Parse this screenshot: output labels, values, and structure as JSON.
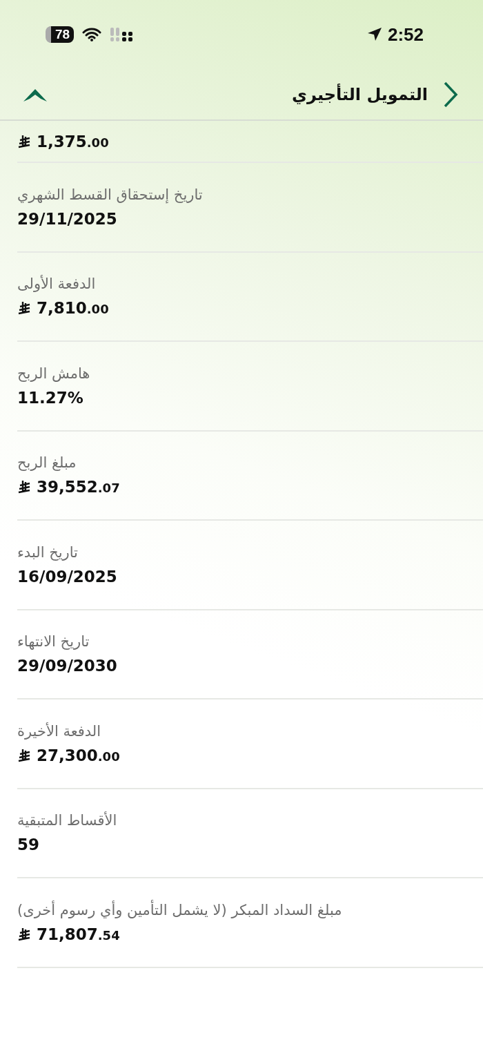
{
  "status_bar": {
    "time": "2:52",
    "battery": "78"
  },
  "header": {
    "title": "التمويل التأجيري"
  },
  "details": [
    {
      "kind": "money",
      "value": "1,375.00"
    },
    {
      "kind": "text",
      "label": "تاريخ إستحقاق القسط الشهري",
      "value": "29/11/2025"
    },
    {
      "kind": "money",
      "label": "الدفعة الأولى",
      "value": "7,810.00"
    },
    {
      "kind": "text",
      "label": "هامش الربح",
      "value": "11.27%"
    },
    {
      "kind": "money",
      "label": "مبلغ الربح",
      "value": "39,552.07"
    },
    {
      "kind": "text",
      "label": "تاريخ البدء",
      "value": "16/09/2025"
    },
    {
      "kind": "text",
      "label": "تاريخ الانتهاء",
      "value": "29/09/2030"
    },
    {
      "kind": "money",
      "label": "الدفعة الأخيرة",
      "value": "27,300.00"
    },
    {
      "kind": "text",
      "label": "الأقساط المتبقية",
      "value": "59"
    },
    {
      "kind": "money",
      "label": "مبلغ السداد المبكر (لا يشمل التأمين وأي رسوم أخرى)",
      "value": "71,807.54"
    }
  ]
}
